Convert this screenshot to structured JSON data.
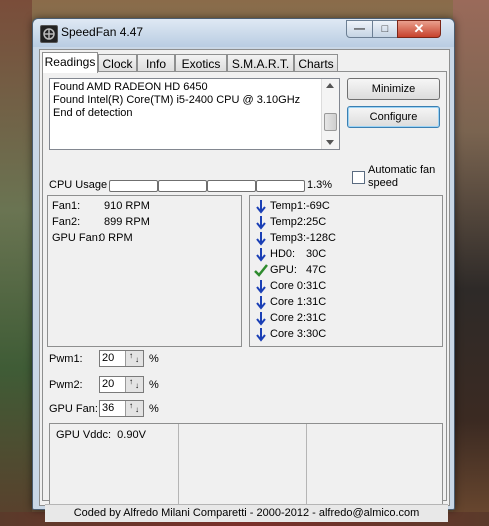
{
  "window": {
    "title": "SpeedFan 4.47"
  },
  "tabs": [
    "Readings",
    "Clock",
    "Info",
    "Exotics",
    "S.M.A.R.T.",
    "Charts"
  ],
  "log": {
    "lines": [
      "Found AMD RADEON HD 6450",
      "Found Intel(R) Core(TM) i5-2400 CPU @ 3.10GHz",
      "End of detection"
    ]
  },
  "buttons": {
    "minimize": "Minimize",
    "configure": "Configure"
  },
  "auto_fan_label": "Automatic fan speed",
  "cpu": {
    "label": "CPU Usage",
    "percent": "1.3%",
    "segments": 4
  },
  "fans": [
    {
      "label": "Fan1:",
      "value": "910 RPM"
    },
    {
      "label": "Fan2:",
      "value": "899 RPM"
    },
    {
      "label": "GPU Fan:",
      "value": "0 RPM"
    }
  ],
  "temps": [
    {
      "label": "Temp1:",
      "value": "-69C",
      "status": "down"
    },
    {
      "label": "Temp2:",
      "value": "25C",
      "status": "down"
    },
    {
      "label": "Temp3:",
      "value": "-128C",
      "status": "down"
    },
    {
      "label": "HD0:",
      "value": "30C",
      "status": "down"
    },
    {
      "label": "GPU:",
      "value": "47C",
      "status": "ok"
    },
    {
      "label": "Core 0:",
      "value": "31C",
      "status": "down"
    },
    {
      "label": "Core 1:",
      "value": "31C",
      "status": "down"
    },
    {
      "label": "Core 2:",
      "value": "31C",
      "status": "down"
    },
    {
      "label": "Core 3:",
      "value": "30C",
      "status": "down"
    }
  ],
  "pwm": [
    {
      "label": "Pwm1:",
      "value": "20",
      "unit": "%"
    },
    {
      "label": "Pwm2:",
      "value": "20",
      "unit": "%"
    },
    {
      "label": "GPU Fan:",
      "value": "36",
      "unit": "%"
    }
  ],
  "voltages": {
    "label": "GPU Vddc:",
    "value": "0.90V"
  },
  "status_bar": "Coded by Alfredo Milani Comparetti - 2000-2012 - alfredo@almico.com",
  "colors": {
    "arrow_down": "#1a3fb5",
    "check_ok": "#2e8b2e"
  }
}
